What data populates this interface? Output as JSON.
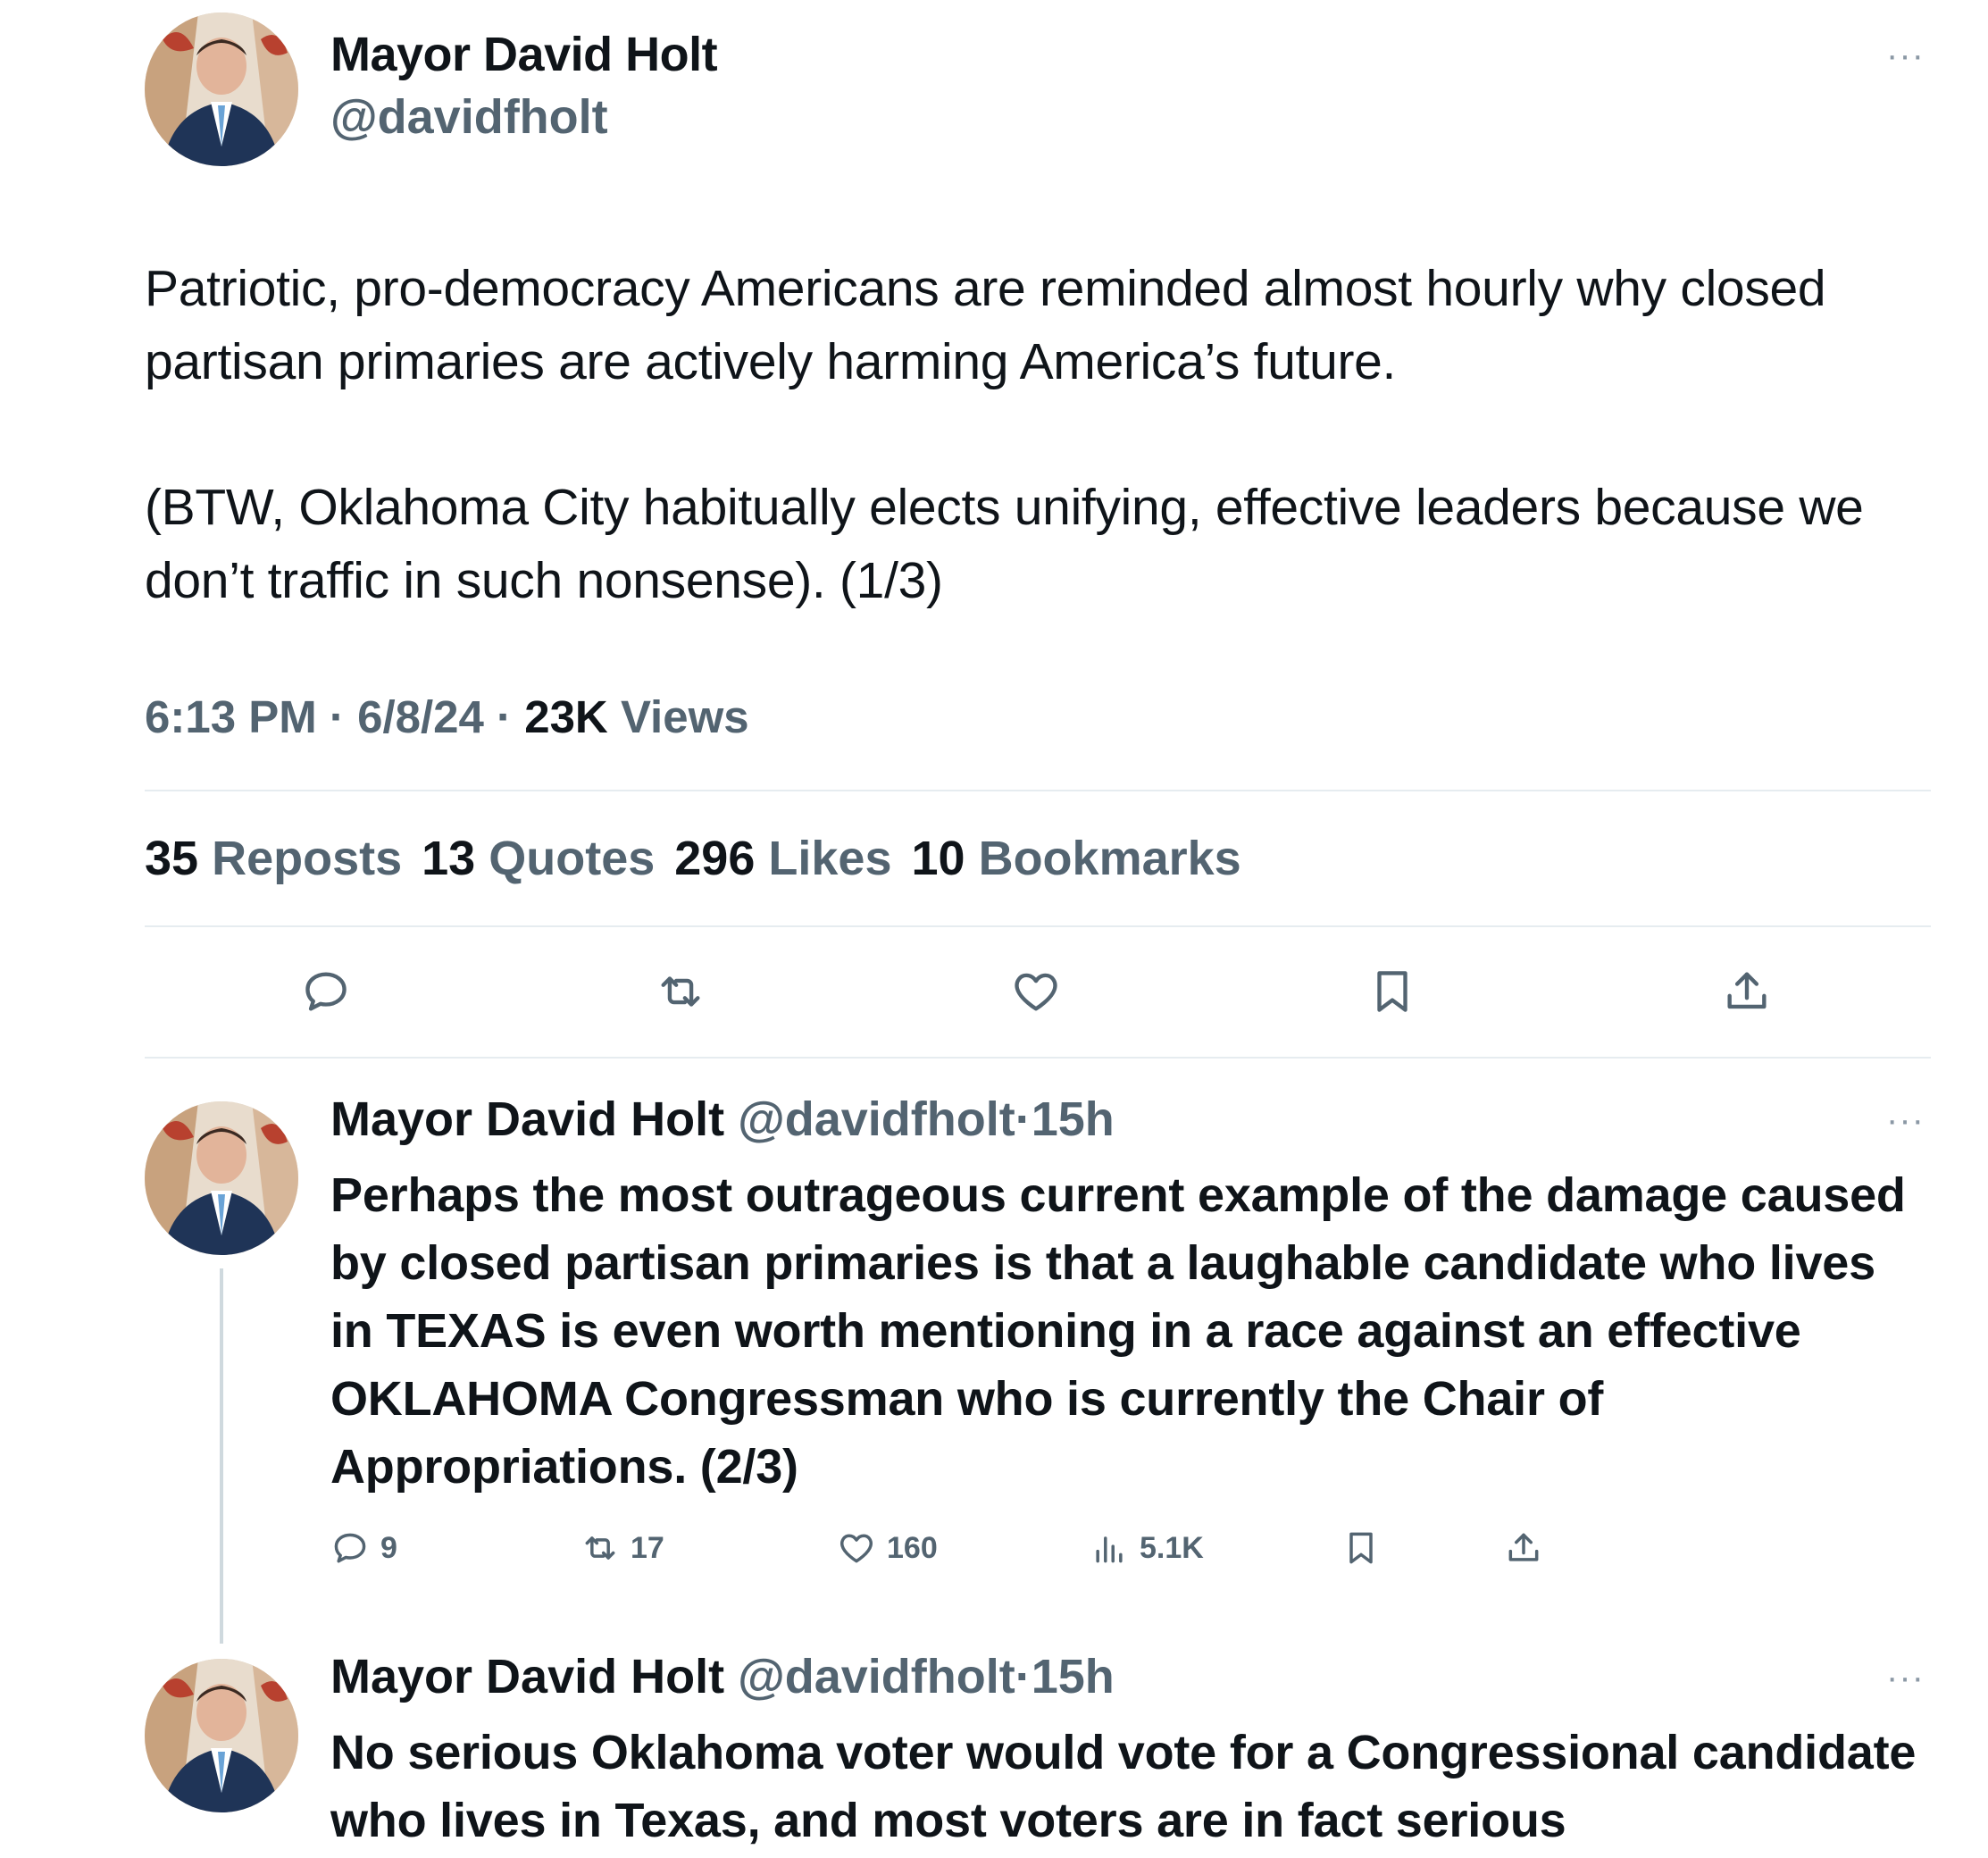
{
  "main_tweet": {
    "author_name": "Mayor David Holt",
    "author_handle": "@davidfholt",
    "more_icon": "more-horizontal-icon",
    "paragraph1": "Patriotic, pro-democracy Americans are reminded almost hourly why closed partisan primaries are actively harming America’s future.",
    "paragraph2": "(BTW, Oklahoma City habitually elects unifying, effective leaders because we don’t traffic in such nonsense).  (1/3)",
    "time": "6:13 PM",
    "date": "6/8/24",
    "views_count": "23K",
    "views_label": "Views",
    "sep": "·",
    "stats": {
      "reposts_count": "35",
      "reposts_label": "Reposts",
      "quotes_count": "13",
      "quotes_label": "Quotes",
      "likes_count": "296",
      "likes_label": "Likes",
      "bookmarks_count": "10",
      "bookmarks_label": "Bookmarks"
    },
    "actions": [
      "reply-icon",
      "repost-icon",
      "like-icon",
      "bookmark-icon",
      "share-icon"
    ]
  },
  "replies": [
    {
      "author_name": "Mayor David Holt",
      "author_handle": "@davidfholt",
      "sep": "·",
      "time": "15h",
      "text": "Perhaps the most outrageous current example of the damage caused by closed partisan primaries is that a laughable candidate who lives in TEXAS is even worth mentioning in a race against an effective OKLAHOMA Congressman who is currently the Chair of Appropriations.  (2/3)",
      "replies_count": "9",
      "reposts_count": "17",
      "likes_count": "160",
      "views_count": "5.1K"
    },
    {
      "author_name": "Mayor David Holt",
      "author_handle": "@davidfholt",
      "sep": "·",
      "time": "15h",
      "text": "No serious Oklahoma voter would vote for a Congressional candidate who lives in Texas, and most voters are in fact serious"
    }
  ],
  "colors": {
    "text": "#0f1419",
    "secondary": "#536471",
    "divider": "#e6ecf0",
    "thread_line": "#cfd9de"
  }
}
